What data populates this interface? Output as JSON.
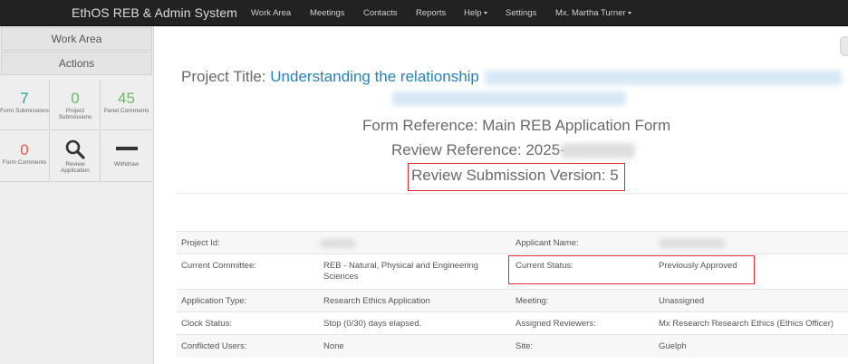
{
  "navbar": {
    "brand": "EthOS REB & Admin System",
    "items": [
      {
        "label": "Work Area"
      },
      {
        "label": "Meetings"
      },
      {
        "label": "Contacts"
      },
      {
        "label": "Reports"
      },
      {
        "label": "Help",
        "dropdown": true
      },
      {
        "label": "Settings"
      },
      {
        "label": "Mx. Martha Turner",
        "dropdown": true
      }
    ]
  },
  "sidebar": {
    "work_area": "Work Area",
    "actions": "Actions",
    "tiles": [
      {
        "value": "7",
        "label": "Form Submissions",
        "color": "#2aa198"
      },
      {
        "value": "0",
        "label": "Project Submissions",
        "color": "#6fb86a"
      },
      {
        "value": "45",
        "label": "Panel Comments",
        "color": "#6fb86a"
      },
      {
        "value": "0",
        "label": "Form Comments",
        "color": "#e05c4f"
      },
      {
        "icon": "magnifier-icon",
        "label": "Review Application"
      },
      {
        "icon": "minus-icon",
        "label": "Withdraw"
      }
    ]
  },
  "header": {
    "project_title_label": "Project Title:",
    "project_title_value": "Understanding the relationship",
    "form_reference": "Form Reference: Main REB Application Form",
    "review_reference": "Review Reference: 2025-",
    "review_version": "Review Submission Version: 5"
  },
  "details": {
    "rows": [
      {
        "k1": "Project Id:",
        "v1": "",
        "k2": "Applicant Name:",
        "v2": ""
      },
      {
        "k1": "Current Committee:",
        "v1": "REB - Natural, Physical and Engineering Sciences",
        "k2": "Current Status:",
        "v2": "Previously Approved"
      },
      {
        "k1": "Application Type:",
        "v1": "Research Ethics Application",
        "k2": "Meeting:",
        "v2": "Unassigned"
      },
      {
        "k1": "Clock Status:",
        "v1": "Stop (0/30) days elapsed.",
        "k2": "Assigned Reviewers:",
        "v2": "Mx Research Research Ethics (Ethics Officer)"
      },
      {
        "k1": "Conflicted Users:",
        "v1": "None",
        "k2": "Site:",
        "v2": "Guelph"
      }
    ]
  },
  "colors": {
    "navbar_bg": "#222222",
    "link": "#2a82b8",
    "highlight_box": "#e03030"
  }
}
